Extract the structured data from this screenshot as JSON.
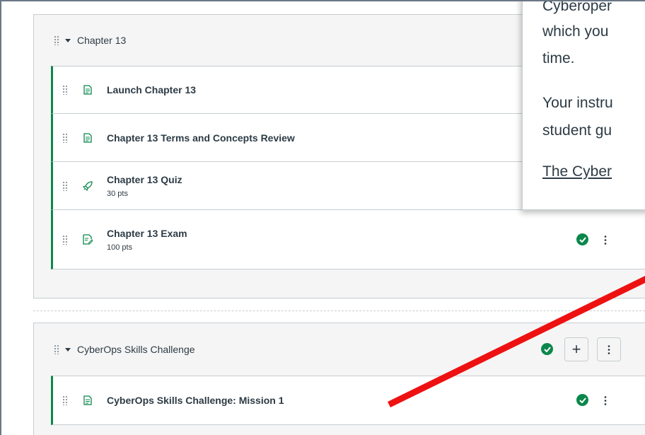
{
  "modules": [
    {
      "title": "Chapter 13",
      "items": [
        {
          "title": "Launch Chapter 13",
          "meta": "",
          "icon": "page-icon"
        },
        {
          "title": "Chapter 13 Terms and Concepts Review",
          "meta": "",
          "icon": "page-icon"
        },
        {
          "title": "Chapter 13 Quiz",
          "meta": "30 pts",
          "icon": "rocket-quiz-icon"
        },
        {
          "title": "Chapter 13 Exam",
          "meta": "100 pts",
          "icon": "assignment-icon",
          "published": true
        }
      ]
    },
    {
      "title": "CyberOps Skills Challenge",
      "published": true,
      "items": [
        {
          "title": "CyberOps Skills Challenge: Mission 1",
          "meta": "",
          "icon": "page-icon",
          "published": true
        }
      ]
    }
  ],
  "popover": {
    "line1": "Cyberoper",
    "line2": "which you",
    "line3": "time.",
    "line4": "Your instru",
    "line5": "student gu",
    "link": "The Cyber"
  },
  "colors": {
    "published": "#0b874b",
    "annotation_arrow": "#ee1111",
    "text": "#2d3b45"
  },
  "add_button_label": "+"
}
